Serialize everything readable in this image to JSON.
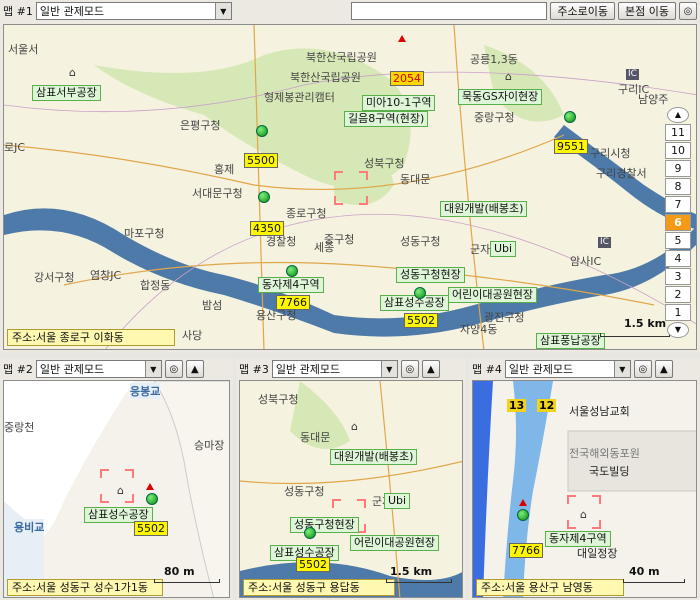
{
  "map1": {
    "label": "맵 #1",
    "mode": "일반 관제모드",
    "search_value": "",
    "address_move_button": "주소로이동",
    "home_move_button": "본점 이동",
    "address": "주소:서울 종로구 이화동",
    "scale": "1.5 km",
    "zoom_levels": [
      "11",
      "10",
      "9",
      "8",
      "7",
      "6",
      "5",
      "4",
      "3",
      "2",
      "1"
    ],
    "zoom_selected": "6",
    "place_labels": [
      "서울서",
      "북한산국립공원",
      "북한산국립공원",
      "형제봉관리캠터",
      "공릉1,3동",
      "은평구청",
      "홍제",
      "서대문구청",
      "종로구청",
      "성북구청",
      "동대문",
      "마포구청",
      "강서구청",
      "염창JC",
      "합정동",
      "경찰청",
      "세종",
      "중구청",
      "성동구청",
      "군자",
      "암사IC",
      "밤섬",
      "용산구청",
      "사당",
      "자양4동",
      "광진구청",
      "로JC",
      "구리IC",
      "남양주",
      "구리시청",
      "구리경찰서",
      "중랑구청"
    ],
    "sites": [
      "삼표서부공장",
      "미아10-1구역",
      "길음8구역(현장)",
      "묵동GS자이현장",
      "대원개발(배봉초)",
      "Ubi",
      "성동구청현장",
      "동자제4구역",
      "어린이대공원현장",
      "삼표성수공장",
      "삼표풍납공장"
    ],
    "vehicles": [
      "2054",
      "5500",
      "9551",
      "4350",
      "7766",
      "5502"
    ]
  },
  "map2": {
    "label": "맵 #2",
    "mode": "일반 관제모드",
    "address": "주소:서울 성동구 성수1가1동",
    "scale": "80 m",
    "place_labels": [
      "응봉교",
      "중랑천",
      "승마장",
      "용비교"
    ],
    "sites": [
      "삼표성수공장"
    ],
    "vehicles": [
      "5502"
    ]
  },
  "map3": {
    "label": "맵 #3",
    "mode": "일반 관제모드",
    "address": "주소:서울 성동구 용답동",
    "scale": "1.5 km",
    "place_labels": [
      "성북구청",
      "동대문",
      "성동구청",
      "군자"
    ],
    "sites": [
      "대원개발(배봉초)",
      "Ubi",
      "성동구청현장",
      "어린이대공원현장",
      "삼표성수공장"
    ],
    "vehicles": [
      "5502"
    ]
  },
  "map4": {
    "label": "맵 #4",
    "mode": "일반 관제모드",
    "address": "주소:서울 용산구 남영동",
    "scale": "40 m",
    "place_labels": [
      "서울성남교회",
      "전국해외동포원",
      "국도빌딩",
      "대일정장",
      "13",
      "12"
    ],
    "sites": [
      "동자제4구역"
    ],
    "vehicles": [
      "7766"
    ]
  },
  "icons": {
    "dropdown": "chevron-down-icon",
    "target": "target-icon",
    "up": "arrow-up-icon",
    "gear": "gear-icon",
    "building": "building-icon",
    "vehicle": "vehicle-marker-icon"
  }
}
